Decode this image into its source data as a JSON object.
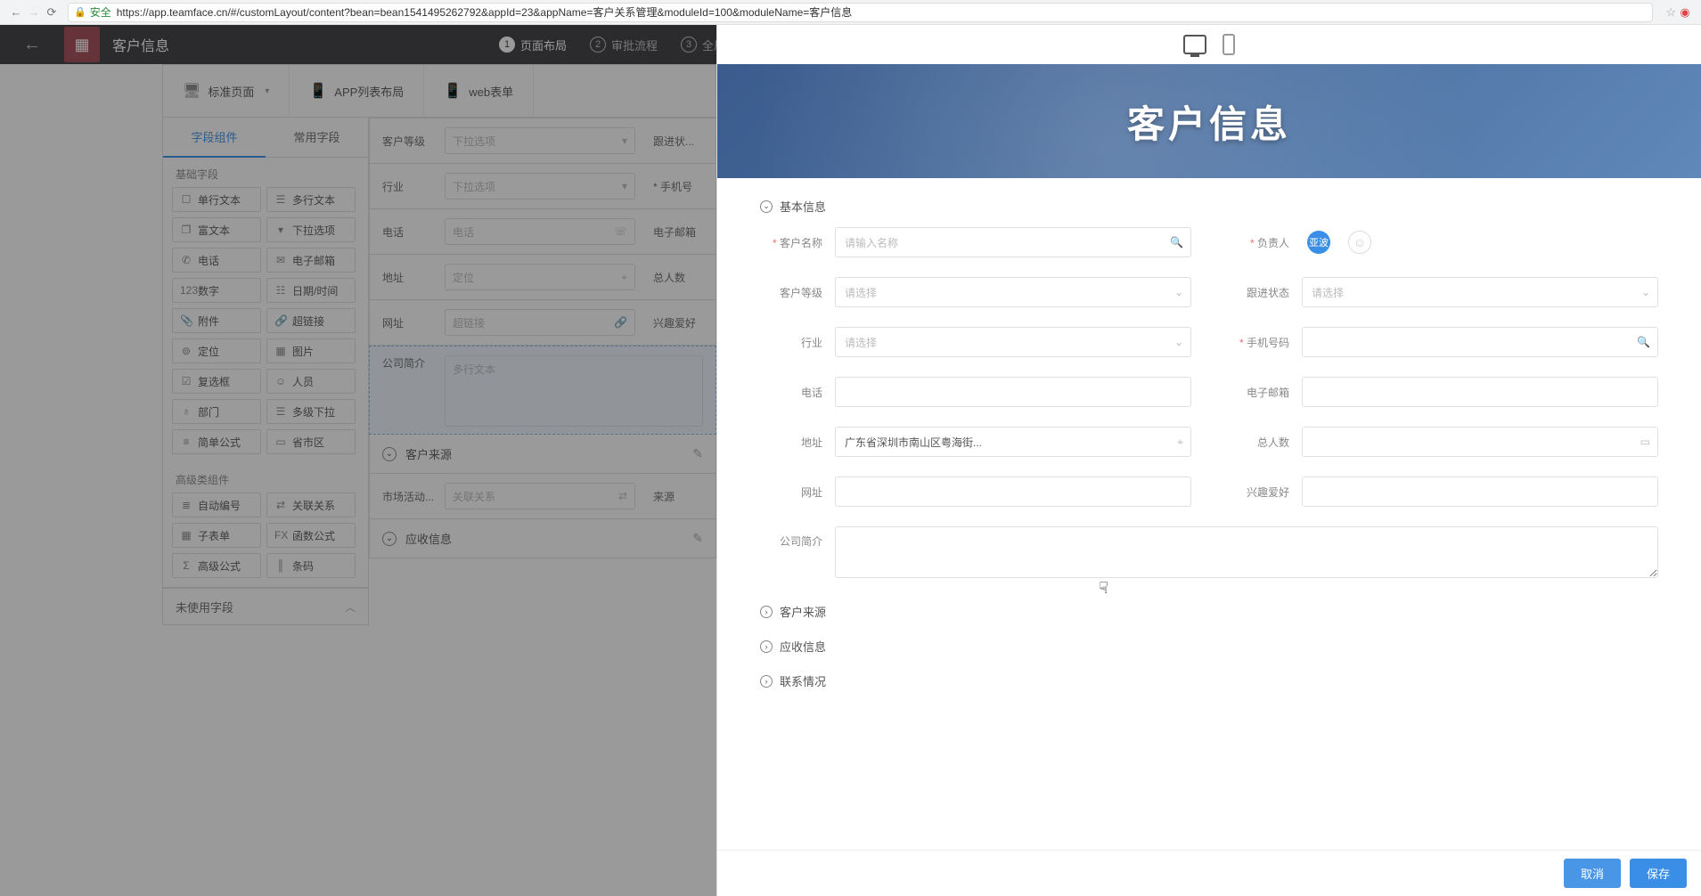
{
  "chrome": {
    "safe_label": "安全",
    "url": "https://app.teamface.cn/#/customLayout/content?bean=bean1541495262792&appId=23&appName=客户关系管理&moduleId=100&moduleName=客户信息"
  },
  "header": {
    "title": "客户信息",
    "steps": [
      {
        "num": "1",
        "label": "页面布局",
        "active": true
      },
      {
        "num": "2",
        "label": "审批流程",
        "active": false
      },
      {
        "num": "3",
        "label": "全局设...",
        "active": false
      }
    ]
  },
  "page_tabs": [
    {
      "icon": "🖥",
      "label": "标准页面",
      "caret": true
    },
    {
      "icon": "📱",
      "label": "APP列表布局",
      "caret": false
    },
    {
      "icon": "📱",
      "label": "web表单",
      "caret": false
    }
  ],
  "palette": {
    "tabs": [
      "字段组件",
      "常用字段"
    ],
    "groups": [
      {
        "title": "基础字段",
        "items": [
          {
            "icon": "☐",
            "label": "单行文本"
          },
          {
            "icon": "☰",
            "label": "多行文本"
          },
          {
            "icon": "❐",
            "label": "富文本"
          },
          {
            "icon": "▾",
            "label": "下拉选项"
          },
          {
            "icon": "✆",
            "label": "电话"
          },
          {
            "icon": "✉",
            "label": "电子邮箱"
          },
          {
            "icon": "123",
            "label": "数字"
          },
          {
            "icon": "☷",
            "label": "日期/时间"
          },
          {
            "icon": "📎",
            "label": "附件"
          },
          {
            "icon": "🔗",
            "label": "超链接"
          },
          {
            "icon": "⊚",
            "label": "定位"
          },
          {
            "icon": "▦",
            "label": "图片"
          },
          {
            "icon": "☑",
            "label": "复选框"
          },
          {
            "icon": "☺",
            "label": "人员"
          },
          {
            "icon": "♁",
            "label": "部门"
          },
          {
            "icon": "☰",
            "label": "多级下拉"
          },
          {
            "icon": "≡",
            "label": "简单公式"
          },
          {
            "icon": "▭",
            "label": "省市区"
          }
        ]
      },
      {
        "title": "高级类组件",
        "items": [
          {
            "icon": "≣",
            "label": "自动编号"
          },
          {
            "icon": "⇄",
            "label": "关联关系"
          },
          {
            "icon": "▦",
            "label": "子表单"
          },
          {
            "icon": "FX",
            "label": "函数公式"
          },
          {
            "icon": "Σ",
            "label": "高级公式"
          },
          {
            "icon": "║",
            "label": "条码"
          }
        ]
      }
    ],
    "unused_label": "未使用字段"
  },
  "builder_form": {
    "rows": [
      {
        "label": "客户等级",
        "ph": "下拉选项",
        "ricon": "▾",
        "rlabel": "跟进状..."
      },
      {
        "label": "行业",
        "ph": "下拉选项",
        "ricon": "▾",
        "rlabel": "手机号",
        "rreq": true
      },
      {
        "label": "电话",
        "ph": "电话",
        "ricon": "☏",
        "rlabel": "电子邮箱"
      },
      {
        "label": "地址",
        "ph": "定位",
        "ricon": "⌖",
        "rlabel": "总人数"
      },
      {
        "label": "网址",
        "ph": "超链接",
        "ricon": "🔗",
        "rlabel": "兴趣爱好"
      }
    ],
    "textarea": {
      "label": "公司简介",
      "ph": "多行文本"
    },
    "sections": [
      "客户来源",
      "应收信息"
    ],
    "last_row": {
      "label": "市场活动...",
      "ph": "关联关系",
      "ricon": "⇄",
      "rlabel": "来源"
    }
  },
  "drawer": {
    "hero_title": "客户信息",
    "section1": "基本信息",
    "fields": {
      "name_label": "客户名称",
      "name_ph": "请输入名称",
      "owner_label": "负责人",
      "owner_chip": "亚波",
      "level_label": "客户等级",
      "level_ph": "请选择",
      "status_label": "跟进状态",
      "status_ph": "请选择",
      "industry_label": "行业",
      "industry_ph": "请选择",
      "mobile_label": "手机号码",
      "phone_label": "电话",
      "email_label": "电子邮箱",
      "address_label": "地址",
      "address_val": "广东省深圳市南山区粤海街...",
      "headcount_label": "总人数",
      "url_label": "网址",
      "hobby_label": "兴趣爱好",
      "desc_label": "公司简介"
    },
    "sections": [
      "客户来源",
      "应收信息",
      "联系情况"
    ],
    "cancel": "取消",
    "save": "保存"
  }
}
